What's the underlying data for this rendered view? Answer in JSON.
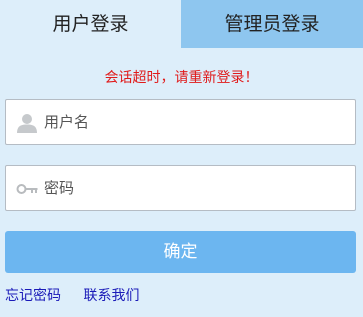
{
  "tabs": {
    "user_login": "用户登录",
    "admin_login": "管理员登录",
    "active": "user_login"
  },
  "notice": "会话超时，请重新登录！",
  "form": {
    "username": {
      "value": "",
      "placeholder": "用户名",
      "icon": "user-icon"
    },
    "password": {
      "value": "",
      "placeholder": "密码",
      "icon": "key-icon"
    },
    "submit_label": "确定"
  },
  "links": {
    "forgot_password": "忘记密码",
    "contact_us": "联系我们"
  },
  "colors": {
    "background": "#ddeefa",
    "active_tab_bg": "#ddeefa",
    "inactive_tab_bg": "#8ec6ef",
    "notice": "#e01b1b",
    "button": "#6cb6f0",
    "link": "#1a1ab8"
  }
}
